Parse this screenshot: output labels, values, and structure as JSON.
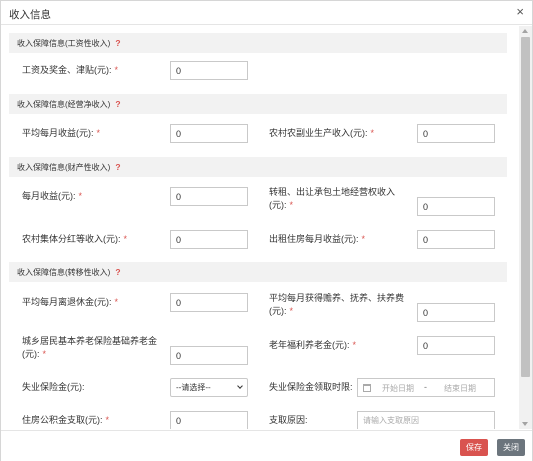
{
  "dialog": {
    "title": "收入信息",
    "close_symbol": "×"
  },
  "sections": {
    "wage": "收入保障信息(工资性收入)",
    "business": "收入保障信息(经营净收入)",
    "property": "收入保障信息(财产性收入)",
    "transfer": "收入保障信息(转移性收入)",
    "help_symbol": "?"
  },
  "fields": {
    "wage_bonus": {
      "label": "工资及奖金、津贴(元):",
      "value": "0"
    },
    "avg_monthly_income": {
      "label": "平均每月收益(元):",
      "value": "0"
    },
    "rural_byproduct": {
      "label": "农村农副业生产收入(元):",
      "value": "0"
    },
    "monthly_income": {
      "label": "每月收益(元):",
      "value": "0"
    },
    "land_transfer": {
      "label_line1": "转租、出让承包土地经营权收入",
      "label_line2": "(元):",
      "value": "0"
    },
    "rural_dividend": {
      "label": "农村集体分红等收入(元):",
      "value": "0"
    },
    "housing_rent": {
      "label": "出租住房每月收益(元):",
      "value": "0"
    },
    "pension": {
      "label": "平均每月离退休金(元):",
      "value": "0"
    },
    "support_fee": {
      "label_line1": "平均每月获得赡养、抚养、扶养费",
      "label_line2": "(元):",
      "value": "0"
    },
    "basic_pension": {
      "label_line1": "城乡居民基本养老保险基础养老金",
      "label_line2": "(元):",
      "value": "0"
    },
    "elderly_welfare": {
      "label": "老年福利养老金(元):",
      "value": "0"
    },
    "unemployment": {
      "label": "失业保险金(元):",
      "selected": "--请选择--"
    },
    "unemployment_period": {
      "label": "失业保险金领取时限:",
      "start_placeholder": "开始日期",
      "separator": "-",
      "end_placeholder": "结束日期"
    },
    "housing_fund": {
      "label": "住房公积金支取(元):",
      "value": "0"
    },
    "withdraw_reason": {
      "label": "支取原因:",
      "placeholder": "请输入支取原因"
    }
  },
  "required_mark": "*",
  "footer": {
    "save_label": "保存",
    "close_label": "关闭"
  },
  "colors": {
    "accent": "#d9534f",
    "secondary": "#6c757d",
    "section_bg": "#f2f2f2"
  }
}
